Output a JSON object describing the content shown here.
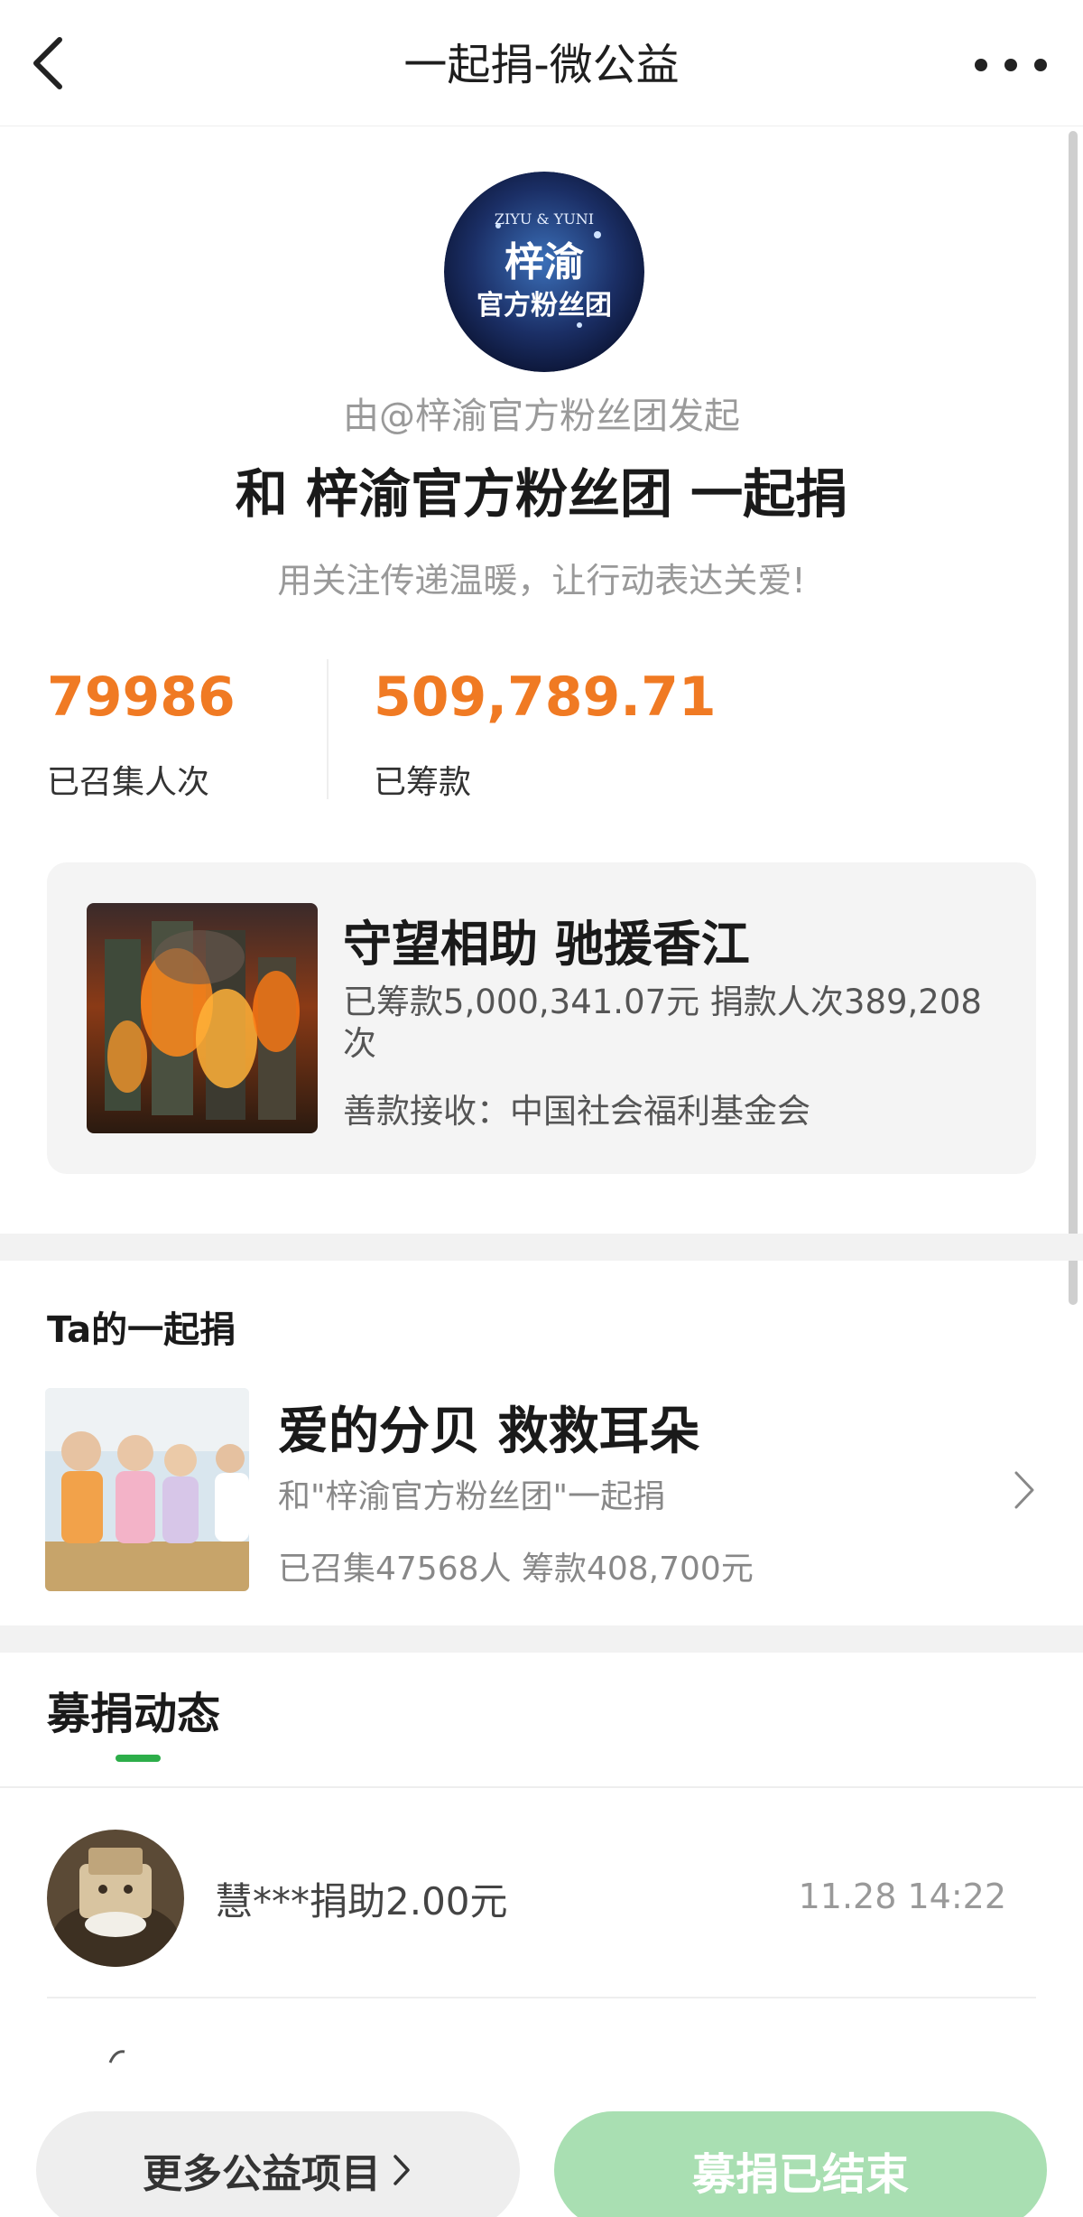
{
  "navbar": {
    "title": "一起捐-微公益",
    "back_icon": "chevron-left-icon",
    "more_icon": "more-dots-icon"
  },
  "header": {
    "avatar_text_line1": "梓渝",
    "avatar_text_line2": "官方粉丝团",
    "avatar_text_top": "ZIYU & YUNI",
    "initiator": "由@梓渝官方粉丝团发起",
    "headline": "和 梓渝官方粉丝团 一起捐",
    "slogan": "用关注传递温暖，让行动表达关爱!"
  },
  "stats": {
    "participants_value": "79986",
    "participants_label": "已召集人次",
    "raised_value": "509,789.71",
    "raised_label": "已筹款"
  },
  "project": {
    "title": "守望相助 驰援香江",
    "amount_line": "已筹款5,000,341.07元  捐款人次389,208次",
    "receiver": "善款接收：中国社会福利基金会"
  },
  "ta_section": {
    "title": "Ta的一起捐",
    "item_title": "爱的分贝 救救耳朵",
    "item_sub": "和\"梓渝官方粉丝团\"一起捐",
    "item_stats": "已召集47568人  筹款408,700元"
  },
  "dynamic": {
    "title": "募捐动态",
    "entries": [
      {
        "text": "慧***捐助2.00元",
        "time": "11.28 14:22"
      }
    ]
  },
  "bottom": {
    "more_label": "更多公益项目",
    "ended_label": "募捐已结束"
  },
  "colors": {
    "accent_orange": "#f07a23",
    "green": "#2dae4a",
    "green_disabled": "#a9dfb2"
  }
}
